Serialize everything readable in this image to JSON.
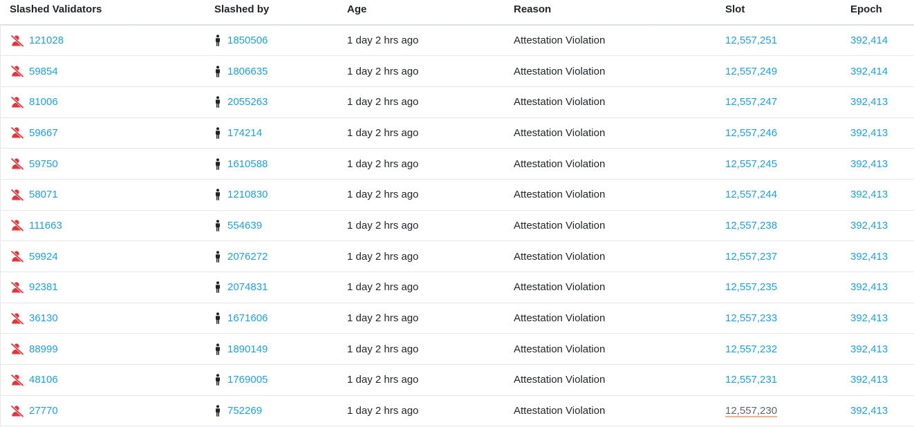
{
  "columns": {
    "validator": "Slashed Validators",
    "slashed_by": "Slashed by",
    "age": "Age",
    "reason": "Reason",
    "slot": "Slot",
    "epoch": "Epoch"
  },
  "colors": {
    "link": "#1da1e2",
    "slashed_icon": "#e8333a",
    "person_icon": "#212529",
    "hover_underline": "#f4b08a"
  },
  "icons": {
    "validator": "slashed-validator-icon",
    "slashed_by": "person-icon"
  },
  "rows": [
    {
      "validator": "121028",
      "slashed_by": "1850506",
      "age": "1 day 2 hrs ago",
      "reason": "Attestation Violation",
      "slot": "12,557,251",
      "epoch": "392,414"
    },
    {
      "validator": "59854",
      "slashed_by": "1806635",
      "age": "1 day 2 hrs ago",
      "reason": "Attestation Violation",
      "slot": "12,557,249",
      "epoch": "392,414"
    },
    {
      "validator": "81006",
      "slashed_by": "2055263",
      "age": "1 day 2 hrs ago",
      "reason": "Attestation Violation",
      "slot": "12,557,247",
      "epoch": "392,413"
    },
    {
      "validator": "59667",
      "slashed_by": "174214",
      "age": "1 day 2 hrs ago",
      "reason": "Attestation Violation",
      "slot": "12,557,246",
      "epoch": "392,413"
    },
    {
      "validator": "59750",
      "slashed_by": "1610588",
      "age": "1 day 2 hrs ago",
      "reason": "Attestation Violation",
      "slot": "12,557,245",
      "epoch": "392,413"
    },
    {
      "validator": "58071",
      "slashed_by": "1210830",
      "age": "1 day 2 hrs ago",
      "reason": "Attestation Violation",
      "slot": "12,557,244",
      "epoch": "392,413"
    },
    {
      "validator": "111663",
      "slashed_by": "554639",
      "age": "1 day 2 hrs ago",
      "reason": "Attestation Violation",
      "slot": "12,557,238",
      "epoch": "392,413"
    },
    {
      "validator": "59924",
      "slashed_by": "2076272",
      "age": "1 day 2 hrs ago",
      "reason": "Attestation Violation",
      "slot": "12,557,237",
      "epoch": "392,413"
    },
    {
      "validator": "92381",
      "slashed_by": "2074831",
      "age": "1 day 2 hrs ago",
      "reason": "Attestation Violation",
      "slot": "12,557,235",
      "epoch": "392,413"
    },
    {
      "validator": "36130",
      "slashed_by": "1671606",
      "age": "1 day 2 hrs ago",
      "reason": "Attestation Violation",
      "slot": "12,557,233",
      "epoch": "392,413"
    },
    {
      "validator": "88999",
      "slashed_by": "1890149",
      "age": "1 day 2 hrs ago",
      "reason": "Attestation Violation",
      "slot": "12,557,232",
      "epoch": "392,413"
    },
    {
      "validator": "48106",
      "slashed_by": "1769005",
      "age": "1 day 2 hrs ago",
      "reason": "Attestation Violation",
      "slot": "12,557,231",
      "epoch": "392,413"
    },
    {
      "validator": "27770",
      "slashed_by": "752269",
      "age": "1 day 2 hrs ago",
      "reason": "Attestation Violation",
      "slot": "12,557,230",
      "epoch": "392,413"
    }
  ]
}
